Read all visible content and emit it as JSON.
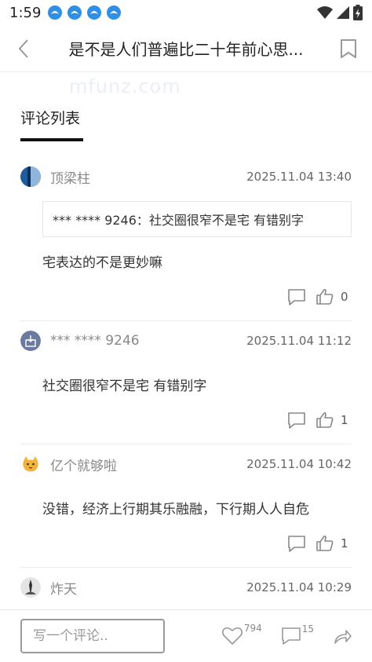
{
  "status_bar": {
    "time": "1:59",
    "notification_icons": [
      "qq-notification-icon",
      "qq-notification-icon",
      "qq-notification-icon",
      "qq-notification-icon"
    ]
  },
  "header": {
    "title": "是不是人们普遍比二十年前心思..."
  },
  "watermark": "mfunz.com",
  "section": {
    "tab_label": "评论列表"
  },
  "comments": [
    {
      "author": "顶梁柱",
      "time": "2025.11.04 13:40",
      "quote": "*** **** 9246：社交圈很窄不是宅 有错别字",
      "content": "宅表达的不是更妙嘛",
      "likes": "0"
    },
    {
      "author": "*** **** 9246",
      "time": "2025.11.04 11:12",
      "content": "社交圈很窄不是宅 有错别字",
      "likes": "1"
    },
    {
      "author": "亿个就够啦",
      "time": "2025.11.04 10:42",
      "content": "没错，经济上行期其乐融融，下行期人人自危",
      "likes": "1"
    },
    {
      "author": "炸天",
      "time": "2025.11.04 10:29"
    }
  ],
  "bottom_bar": {
    "input_placeholder": "写一个评论..",
    "like_count": "794",
    "comment_count": "15"
  },
  "colors": {
    "accent": "#111111",
    "notification_blue": "#2f8ee5",
    "muted_text": "#888888"
  }
}
